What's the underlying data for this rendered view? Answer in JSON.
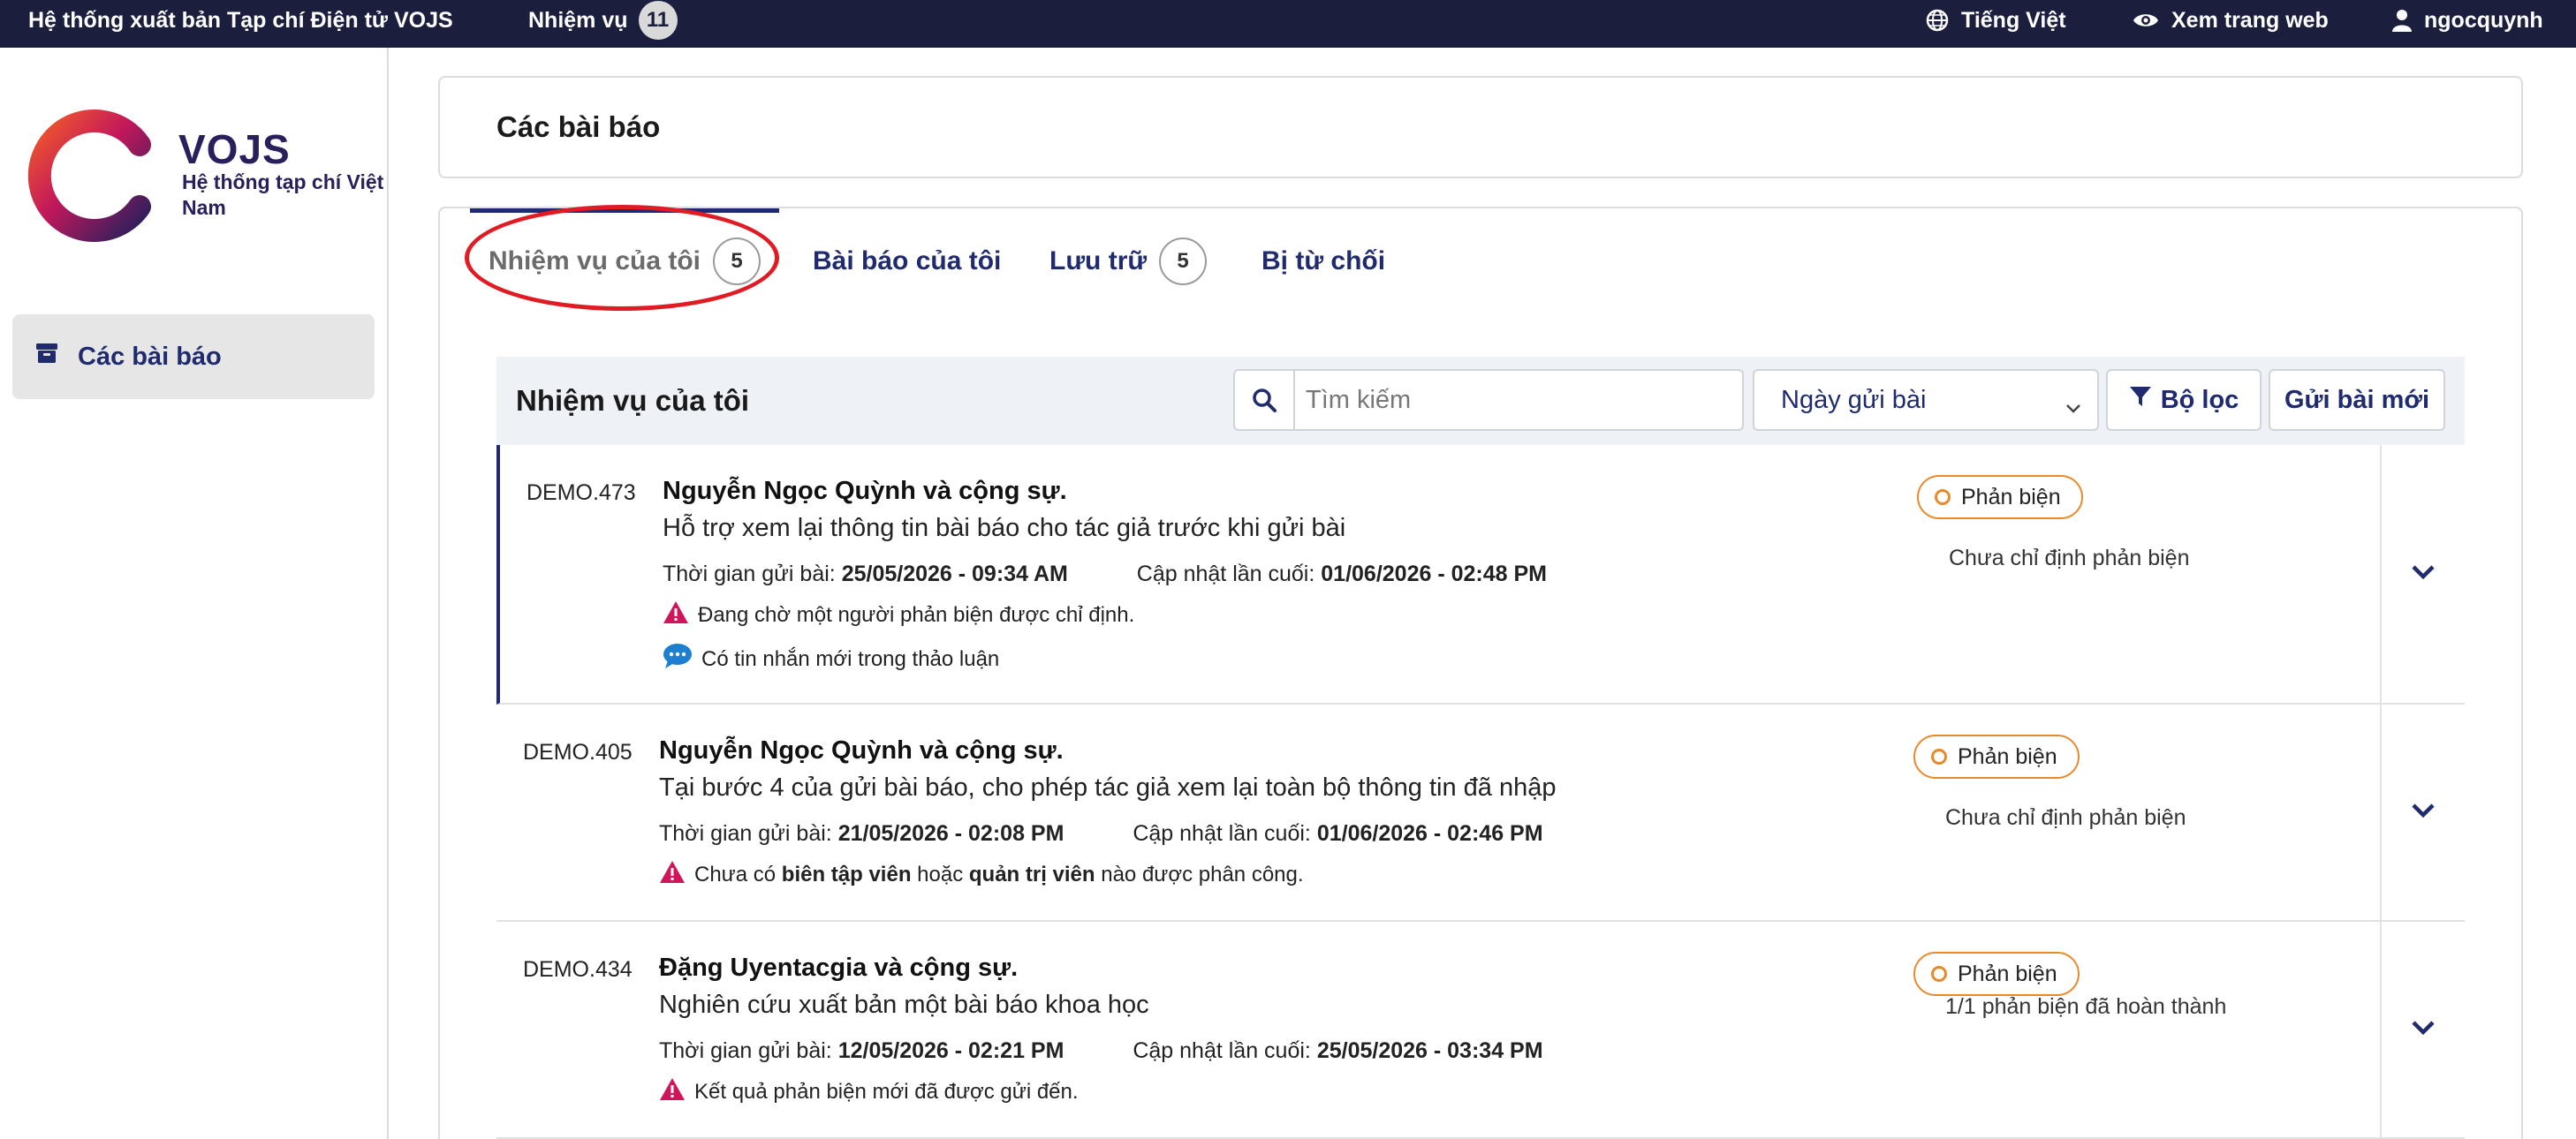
{
  "topbar": {
    "site_title": "Hệ thống xuất bản Tạp chí Điện tử VOJS",
    "tasks_label": "Nhiệm vụ",
    "tasks_count": "11",
    "language": "Tiếng Việt",
    "view_site": "Xem trang web",
    "username": "ngocquynh"
  },
  "sidebar": {
    "logo_name": "VOJS",
    "logo_subtitle": "Hệ thống tạp chí Việt Nam",
    "items": [
      {
        "label": "Các bài báo",
        "icon": "archive-icon"
      }
    ]
  },
  "page": {
    "title": "Các bài báo"
  },
  "tabs": [
    {
      "label": "Nhiệm vụ của tôi",
      "count": "5",
      "active": true
    },
    {
      "label": "Bài báo của tôi"
    },
    {
      "label": "Lưu trữ",
      "count": "5"
    },
    {
      "label": "Bị từ chối"
    }
  ],
  "list": {
    "title": "Nhiệm vụ của tôi",
    "search_placeholder": "Tìm kiếm",
    "sort_value": "Ngày gửi bài",
    "filter_label": "Bộ lọc",
    "new_submission_label": "Gửi bài mới"
  },
  "submissions": [
    {
      "id": "DEMO.473",
      "authors": "Nguyễn Ngọc Quỳnh và cộng sự.",
      "title": "Hỗ trợ xem lại thông tin bài báo cho tác giả trước khi gửi bài",
      "submitted_label": "Thời gian gửi bài:",
      "submitted_value": "25/05/2026 - 09:34 AM",
      "updated_label": "Cập nhật lần cuối:",
      "updated_value": "01/06/2026 - 02:48 PM",
      "note_warning": "Đang chờ một người phản biện được chỉ định.",
      "note_message": "Có tin nhắn mới trong thảo luận",
      "stage": "Phản biện",
      "stage_status": "Chưa chỉ định phản biện"
    },
    {
      "id": "DEMO.405",
      "authors": "Nguyễn Ngọc Quỳnh và cộng sự.",
      "title": "Tại bước 4 của gửi bài báo, cho phép tác giả xem lại toàn bộ thông tin đã nhập",
      "submitted_label": "Thời gian gửi bài:",
      "submitted_value": "21/05/2026 - 02:08 PM",
      "updated_label": "Cập nhật lần cuối:",
      "updated_value": "01/06/2026 - 02:46 PM",
      "note_prefix": "Chưa có",
      "note_bold1": "biên tập viên",
      "note_mid": "hoặc",
      "note_bold2": "quản trị viên",
      "note_suffix": "nào được phân công.",
      "stage": "Phản biện",
      "stage_status": "Chưa chỉ định phản biện"
    },
    {
      "id": "DEMO.434",
      "authors": "Đặng Uyentacgia và cộng sự.",
      "title": "Nghiên cứu xuất bản một bài báo khoa học",
      "submitted_label": "Thời gian gửi bài:",
      "submitted_value": "12/05/2026 - 02:21 PM",
      "updated_label": "Cập nhật lần cuối:",
      "updated_value": "25/05/2026 - 03:34 PM",
      "note_warning": "Kết quả phản biện mới đã được gửi đến.",
      "stage": "Phản biện",
      "stage_status": "1/1 phản biện đã hoàn thành"
    }
  ],
  "colors": {
    "topbar": "#1b1f3d",
    "brand": "#1f2b6e",
    "stage_badge": "#e8892b",
    "warning": "#d0155b",
    "message": "#1e7fd1",
    "highlight": "#e01b24"
  }
}
